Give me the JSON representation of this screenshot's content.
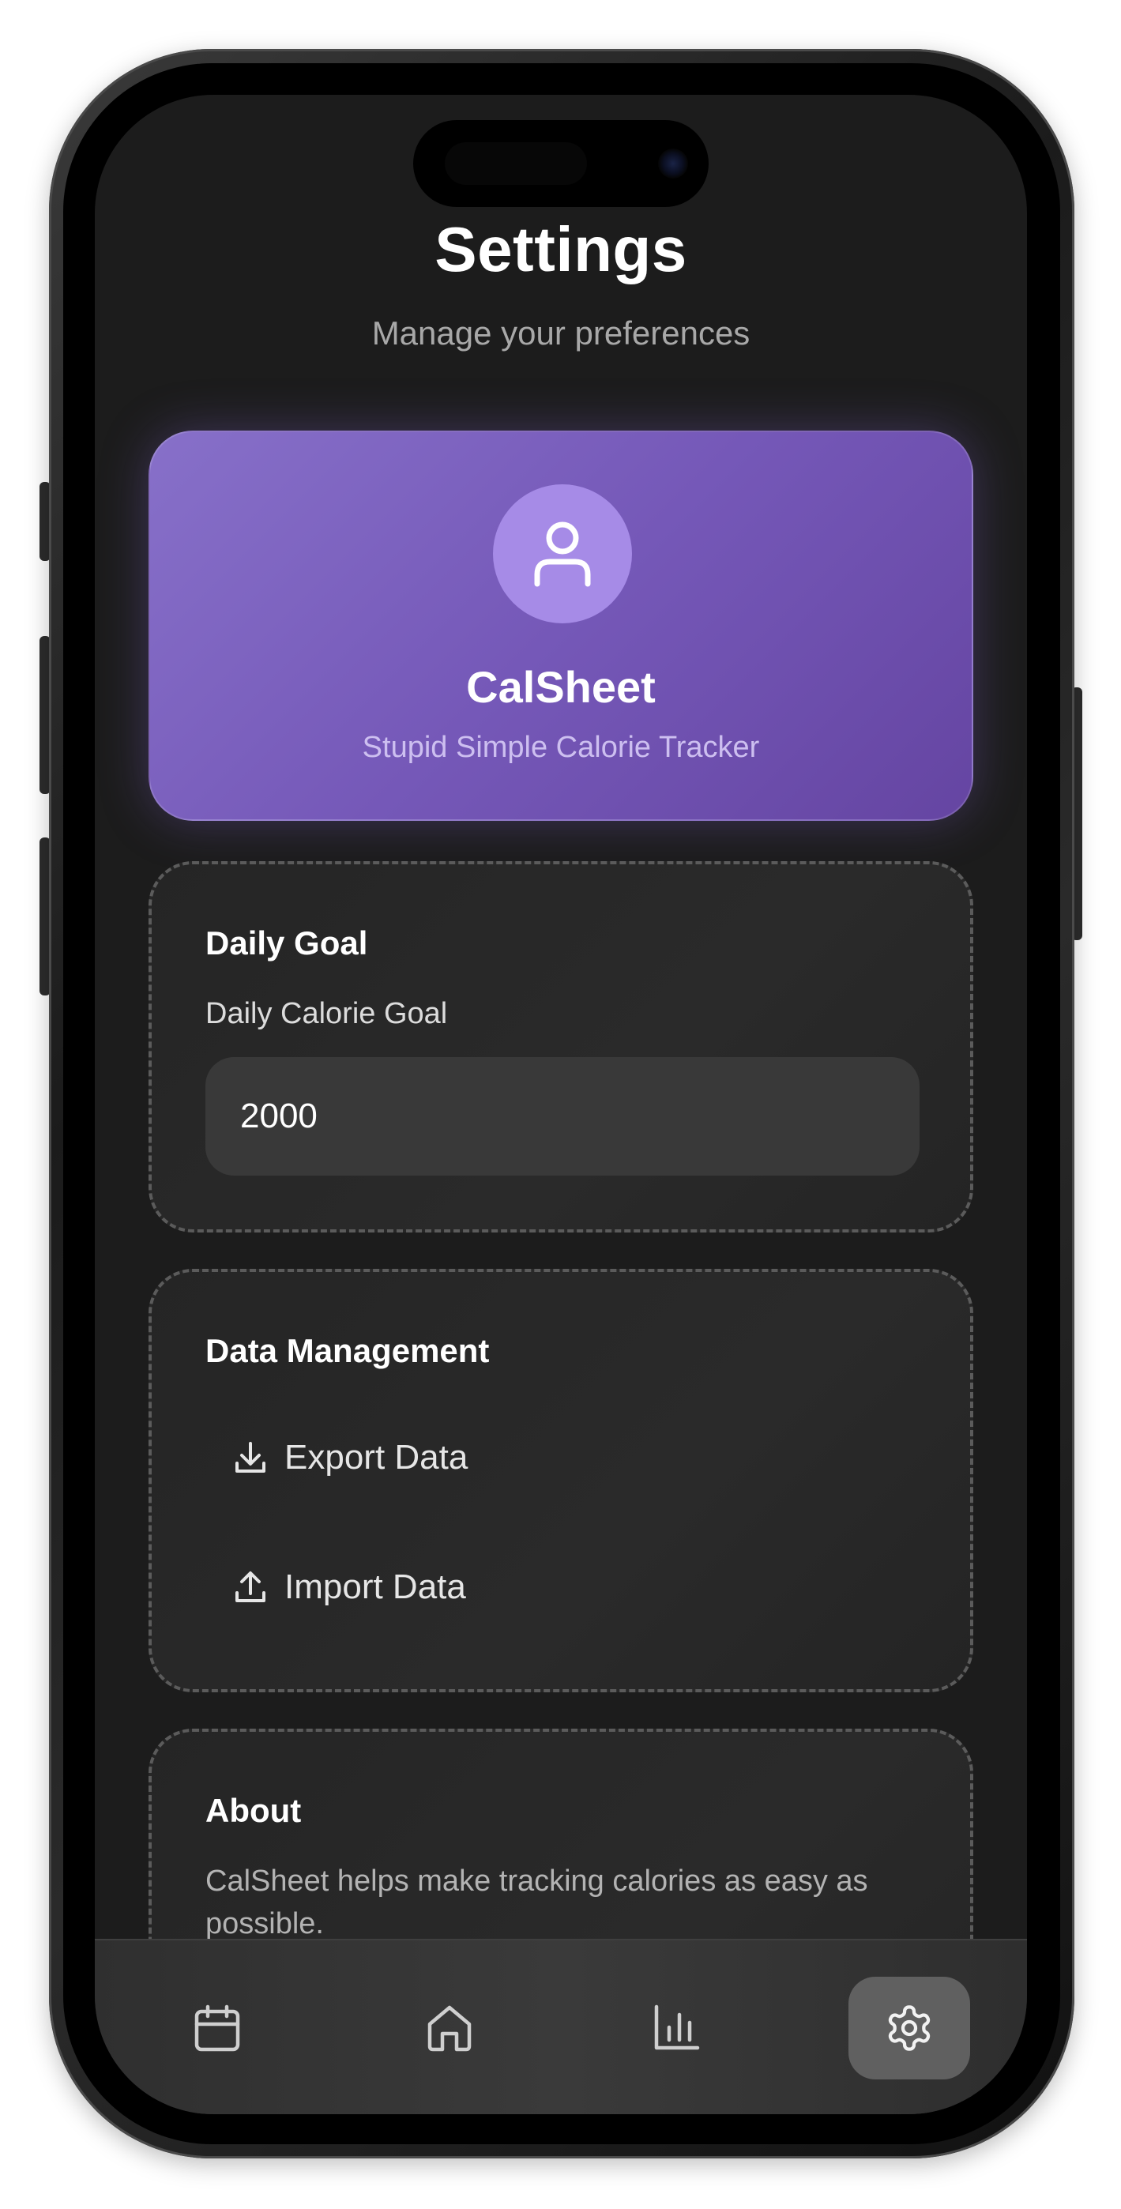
{
  "header": {
    "title": "Settings",
    "subtitle": "Manage your preferences"
  },
  "profile": {
    "icon": "user-icon",
    "app_name": "CalSheet",
    "tagline": "Stupid Simple Calorie Tracker"
  },
  "daily_goal": {
    "title": "Daily Goal",
    "field_label": "Daily Calorie Goal",
    "value": "2000"
  },
  "data_management": {
    "title": "Data Management",
    "export_label": "Export Data",
    "export_icon": "download-icon",
    "import_label": "Import Data",
    "import_icon": "upload-icon"
  },
  "about": {
    "title": "About",
    "text": "CalSheet helps make tracking calories as easy as possible."
  },
  "nav": {
    "items": [
      {
        "icon": "calendar-icon",
        "active": false
      },
      {
        "icon": "home-icon",
        "active": false
      },
      {
        "icon": "bar-chart-icon",
        "active": false
      },
      {
        "icon": "gear-icon",
        "active": true
      }
    ]
  },
  "colors": {
    "accent": "#7558b8",
    "background": "#1c1c1c",
    "card": "#2a2a2a"
  }
}
